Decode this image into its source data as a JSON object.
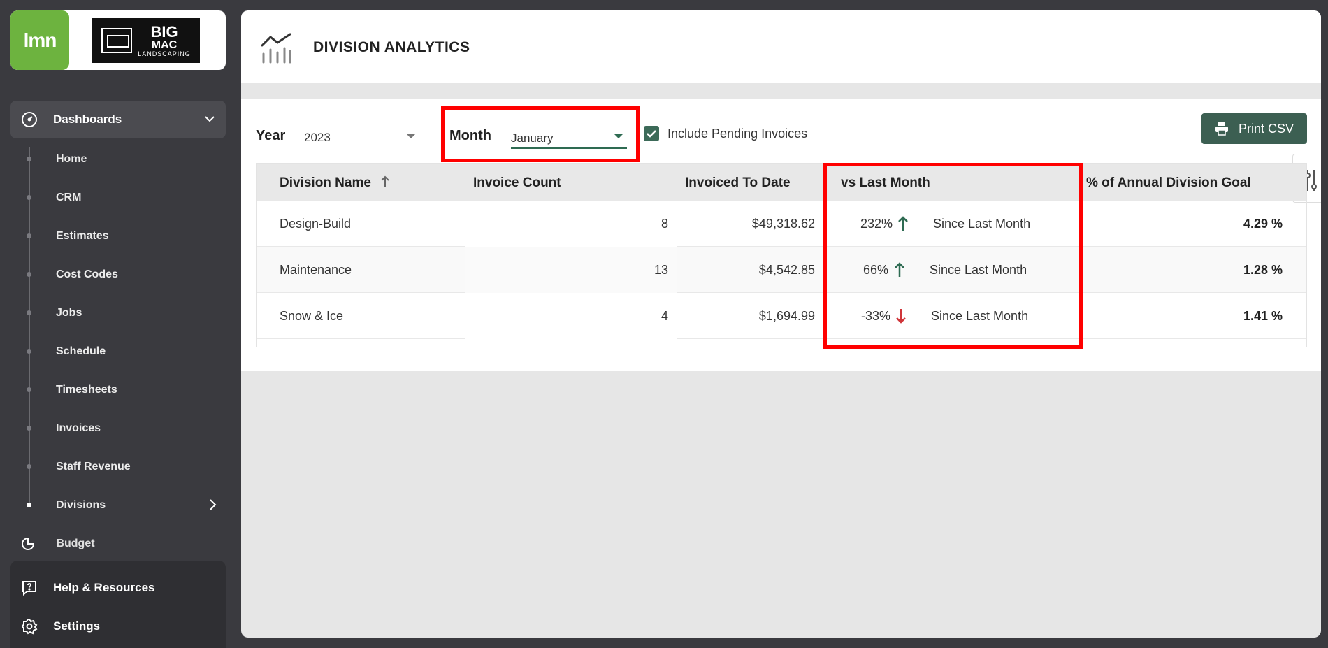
{
  "brand": {
    "lmn_logo": "lmn",
    "company_line1": "BIG",
    "company_line2": "MAC",
    "company_line3": "LANDSCAPING"
  },
  "sidebar": {
    "dashboards_label": "Dashboards",
    "items": [
      {
        "label": "Home"
      },
      {
        "label": "CRM"
      },
      {
        "label": "Estimates"
      },
      {
        "label": "Cost Codes"
      },
      {
        "label": "Jobs"
      },
      {
        "label": "Schedule"
      },
      {
        "label": "Timesheets"
      },
      {
        "label": "Invoices"
      },
      {
        "label": "Staff Revenue"
      },
      {
        "label": "Divisions"
      }
    ],
    "budget_label": "Budget",
    "help_label": "Help & Resources",
    "settings_label": "Settings"
  },
  "page": {
    "title": "DIVISION ANALYTICS"
  },
  "filters": {
    "year_label": "Year",
    "year_value": "2023",
    "month_label": "Month",
    "month_value": "January",
    "include_pending_label": "Include Pending Invoices",
    "include_pending_checked": true,
    "print_label": "Print CSV"
  },
  "table": {
    "headers": {
      "division_name": "Division Name",
      "invoice_count": "Invoice Count",
      "invoiced_to_date": "Invoiced To Date",
      "vs_last_month": "vs Last Month",
      "annual_goal": "% of Annual Division Goal"
    },
    "rows": [
      {
        "division": "Design-Build",
        "count": "8",
        "invoiced": "$49,318.62",
        "change": "232%",
        "direction": "up",
        "since": "Since Last Month",
        "goal": "4.29 %"
      },
      {
        "division": "Maintenance",
        "count": "13",
        "invoiced": "$4,542.85",
        "change": "66%",
        "direction": "up",
        "since": "Since Last Month",
        "goal": "1.28 %"
      },
      {
        "division": "Snow & Ice",
        "count": "4",
        "invoiced": "$1,694.99",
        "change": "-33%",
        "direction": "down",
        "since": "Since Last Month",
        "goal": "1.41 %"
      }
    ]
  },
  "colors": {
    "sidebar_bg": "#3a3a3f",
    "lmn_green": "#6db33f",
    "accent_green": "#3c5f52",
    "up_arrow": "#2e6b52",
    "down_arrow": "#d0353a",
    "highlight_red": "#ff0000"
  }
}
